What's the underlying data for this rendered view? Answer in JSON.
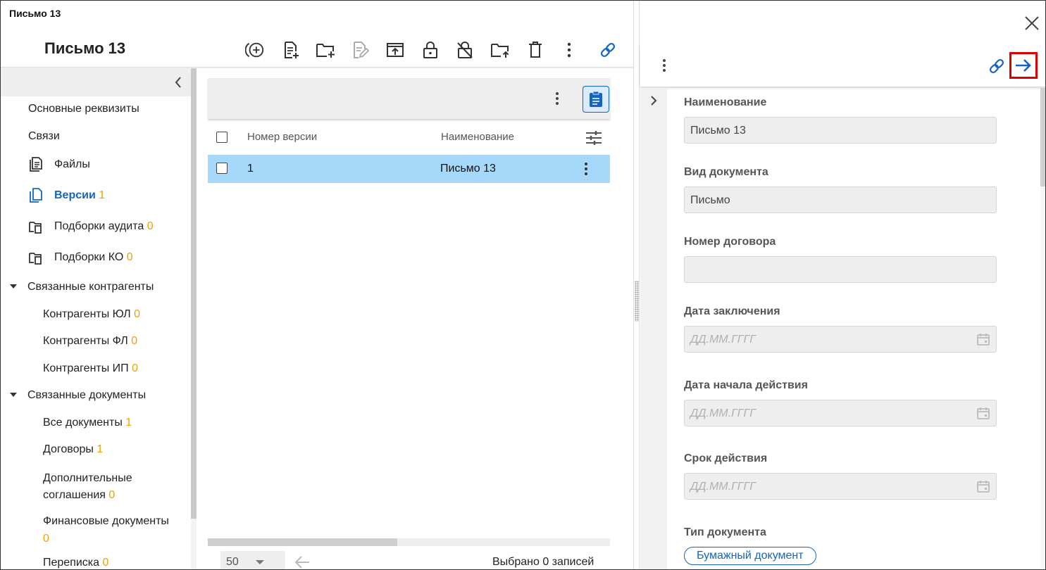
{
  "window": {
    "title": "Письмо 13"
  },
  "document": {
    "title": "Письмо 13"
  },
  "toolbar": {
    "icons": [
      "add-circle-icon",
      "add-file-icon",
      "add-folder-icon",
      "edit-file-icon",
      "upload-icon",
      "unlock-icon",
      "lock-off-icon",
      "folder-upload-icon",
      "delete-icon",
      "more-icon",
      "link-icon"
    ]
  },
  "sidebar": {
    "items": [
      {
        "label": "Основные реквизиты"
      },
      {
        "label": "Связи"
      },
      {
        "label": "Файлы",
        "icon": "file-icon"
      },
      {
        "label": "Версии",
        "count": "1",
        "icon": "copy-icon",
        "active": true
      },
      {
        "label": "Подборки аудита",
        "count": "0",
        "icon": "collection-icon"
      },
      {
        "label": "Подборки КО",
        "count": "0",
        "icon": "collection-icon"
      }
    ],
    "group_contragents": {
      "label": "Связанные контрагенты",
      "items": [
        {
          "label": "Контрагенты ЮЛ",
          "count": "0"
        },
        {
          "label": "Контрагенты ФЛ",
          "count": "0"
        },
        {
          "label": "Контрагенты ИП",
          "count": "0"
        }
      ]
    },
    "group_documents": {
      "label": "Связанные документы",
      "items": [
        {
          "label": "Все документы",
          "count": "1"
        },
        {
          "label": "Договоры",
          "count": "1"
        },
        {
          "label": "Дополнительные",
          "label2": "соглашения",
          "count": "0"
        },
        {
          "label": "Финансовые документы",
          "count": "0"
        },
        {
          "label": "Переписка",
          "count": "0"
        }
      ]
    }
  },
  "table": {
    "columns": [
      "Номер версии",
      "Наименование"
    ],
    "rows": [
      {
        "version": "1",
        "name": "Письмо 13"
      }
    ],
    "page_size": "50",
    "selected_text": "Выбрано 0 записей"
  },
  "panel": {
    "fields": [
      {
        "label": "Наименование",
        "value": "Письмо 13"
      },
      {
        "label": "Вид документа",
        "value": "Письмо"
      },
      {
        "label": "Номер договора",
        "value": ""
      },
      {
        "label": "Дата заключения",
        "placeholder": "ДД.ММ.ГГГГ"
      },
      {
        "label": "Дата начала действия",
        "placeholder": "ДД.ММ.ГГГГ"
      },
      {
        "label": "Срок действия",
        "placeholder": "ДД.ММ.ГГГГ"
      },
      {
        "label": "Тип документа",
        "chip": "Бумажный документ"
      }
    ]
  },
  "colors": {
    "accent": "#1565c0",
    "count": "#f0a100",
    "selected_row": "#a6d8fa",
    "highlight": "#e00000"
  }
}
